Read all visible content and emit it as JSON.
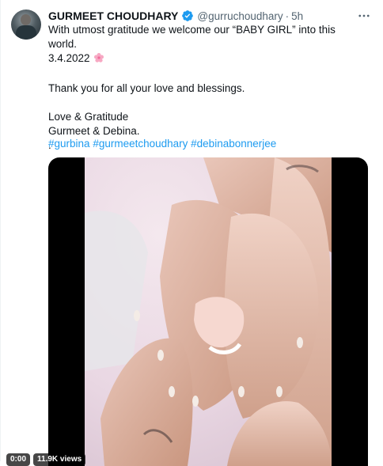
{
  "tweet": {
    "author_name": "GURMEET CHOUDHARY",
    "handle": "@gurruchoudhary",
    "separator": "·",
    "time": "5h",
    "lines": [
      "With utmost gratitude we welcome our “BABY GIRL” into this world.",
      "3.4.2022",
      "",
      "Thank you for all your love and blessings.",
      "",
      "Love & Gratitude",
      "Gurmeet & Debina.",
      "."
    ],
    "hashtags": [
      "#gurbina",
      "#gurmeetchoudhary",
      "#debinabonnerjee"
    ]
  },
  "icons": {
    "verified": "verified-badge-icon",
    "more": "more-options-icon",
    "flower": "cherry-blossom-icon"
  },
  "video": {
    "time_label": "0:00",
    "views_label": "11.9K views"
  },
  "colors": {
    "accent": "#1d9bf0",
    "secondary_text": "#536471",
    "primary_text": "#0f1419"
  }
}
